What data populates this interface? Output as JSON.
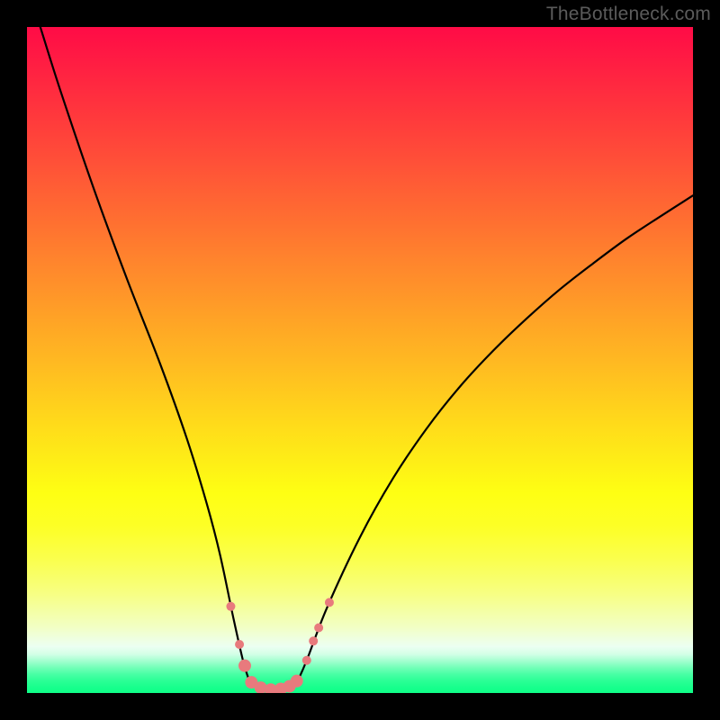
{
  "watermark": {
    "text": "TheBottleneck.com"
  },
  "colors": {
    "black": "#000000",
    "curve_stroke": "#000000",
    "marker_fill": "#e87a7d",
    "marker_stroke": "#d35c60",
    "gradient_stops": [
      {
        "offset": 0.0,
        "color": "#ff0b46"
      },
      {
        "offset": 0.05,
        "color": "#ff1c43"
      },
      {
        "offset": 0.1,
        "color": "#ff2d3f"
      },
      {
        "offset": 0.15,
        "color": "#ff3e3b"
      },
      {
        "offset": 0.2,
        "color": "#ff4f38"
      },
      {
        "offset": 0.25,
        "color": "#ff6134"
      },
      {
        "offset": 0.3,
        "color": "#ff7230"
      },
      {
        "offset": 0.35,
        "color": "#ff842d"
      },
      {
        "offset": 0.4,
        "color": "#ff9529"
      },
      {
        "offset": 0.45,
        "color": "#ffa725"
      },
      {
        "offset": 0.5,
        "color": "#ffb822"
      },
      {
        "offset": 0.55,
        "color": "#ffca1e"
      },
      {
        "offset": 0.6,
        "color": "#ffdc1a"
      },
      {
        "offset": 0.65,
        "color": "#feed17"
      },
      {
        "offset": 0.7,
        "color": "#feff13"
      },
      {
        "offset": 0.75,
        "color": "#fdff26"
      },
      {
        "offset": 0.8,
        "color": "#faff4e"
      },
      {
        "offset": 0.85,
        "color": "#f7ff82"
      },
      {
        "offset": 0.9,
        "color": "#f2ffc3"
      },
      {
        "offset": 0.93,
        "color": "#ecfff2"
      },
      {
        "offset": 0.942,
        "color": "#d2ffe6"
      },
      {
        "offset": 0.952,
        "color": "#a2ffcf"
      },
      {
        "offset": 0.962,
        "color": "#72ffb8"
      },
      {
        "offset": 0.972,
        "color": "#48ffa4"
      },
      {
        "offset": 0.982,
        "color": "#2aff95"
      },
      {
        "offset": 0.992,
        "color": "#17ff8c"
      },
      {
        "offset": 1.0,
        "color": "#0fff88"
      }
    ]
  },
  "chart_data": {
    "type": "line",
    "title": "",
    "xlabel": "",
    "ylabel": "",
    "xlim": [
      0,
      100
    ],
    "ylim": [
      0,
      100
    ],
    "grid": false,
    "legend": false,
    "series": [
      {
        "name": "left-branch",
        "x": [
          2,
          5,
          10,
          15,
          20,
          24,
          27,
          29,
          31,
          32.5,
          33.5
        ],
        "y": [
          100,
          90.5,
          75.8,
          62.2,
          49.4,
          38.2,
          28.4,
          20.7,
          11.2,
          4.6,
          1.5
        ]
      },
      {
        "name": "right-branch",
        "x": [
          40.5,
          42,
          45,
          50,
          55,
          60,
          65,
          70,
          75,
          80,
          85,
          90,
          95,
          100
        ],
        "y": [
          1.5,
          4.9,
          12.7,
          23.4,
          32.3,
          39.7,
          46.0,
          51.4,
          56.2,
          60.6,
          64.5,
          68.2,
          71.5,
          74.7
        ]
      },
      {
        "name": "valley-floor",
        "x": [
          33.5,
          35,
          37,
          39,
          40.5
        ],
        "y": [
          1.5,
          0.7,
          0.5,
          0.7,
          1.5
        ]
      }
    ],
    "markers": {
      "name": "highlighted-points",
      "radius_big": 7,
      "radius_small": 5,
      "points": [
        {
          "x": 30.6,
          "y": 13.0,
          "r": 5
        },
        {
          "x": 31.9,
          "y": 7.3,
          "r": 5
        },
        {
          "x": 32.7,
          "y": 4.1,
          "r": 7
        },
        {
          "x": 33.7,
          "y": 1.6,
          "r": 7
        },
        {
          "x": 35.1,
          "y": 0.8,
          "r": 7
        },
        {
          "x": 36.6,
          "y": 0.5,
          "r": 7
        },
        {
          "x": 38.1,
          "y": 0.6,
          "r": 7
        },
        {
          "x": 39.4,
          "y": 1.0,
          "r": 7
        },
        {
          "x": 40.5,
          "y": 1.8,
          "r": 7
        },
        {
          "x": 42.0,
          "y": 4.9,
          "r": 5
        },
        {
          "x": 43.0,
          "y": 7.8,
          "r": 5
        },
        {
          "x": 43.8,
          "y": 9.8,
          "r": 5
        },
        {
          "x": 45.4,
          "y": 13.6,
          "r": 5
        }
      ]
    }
  }
}
